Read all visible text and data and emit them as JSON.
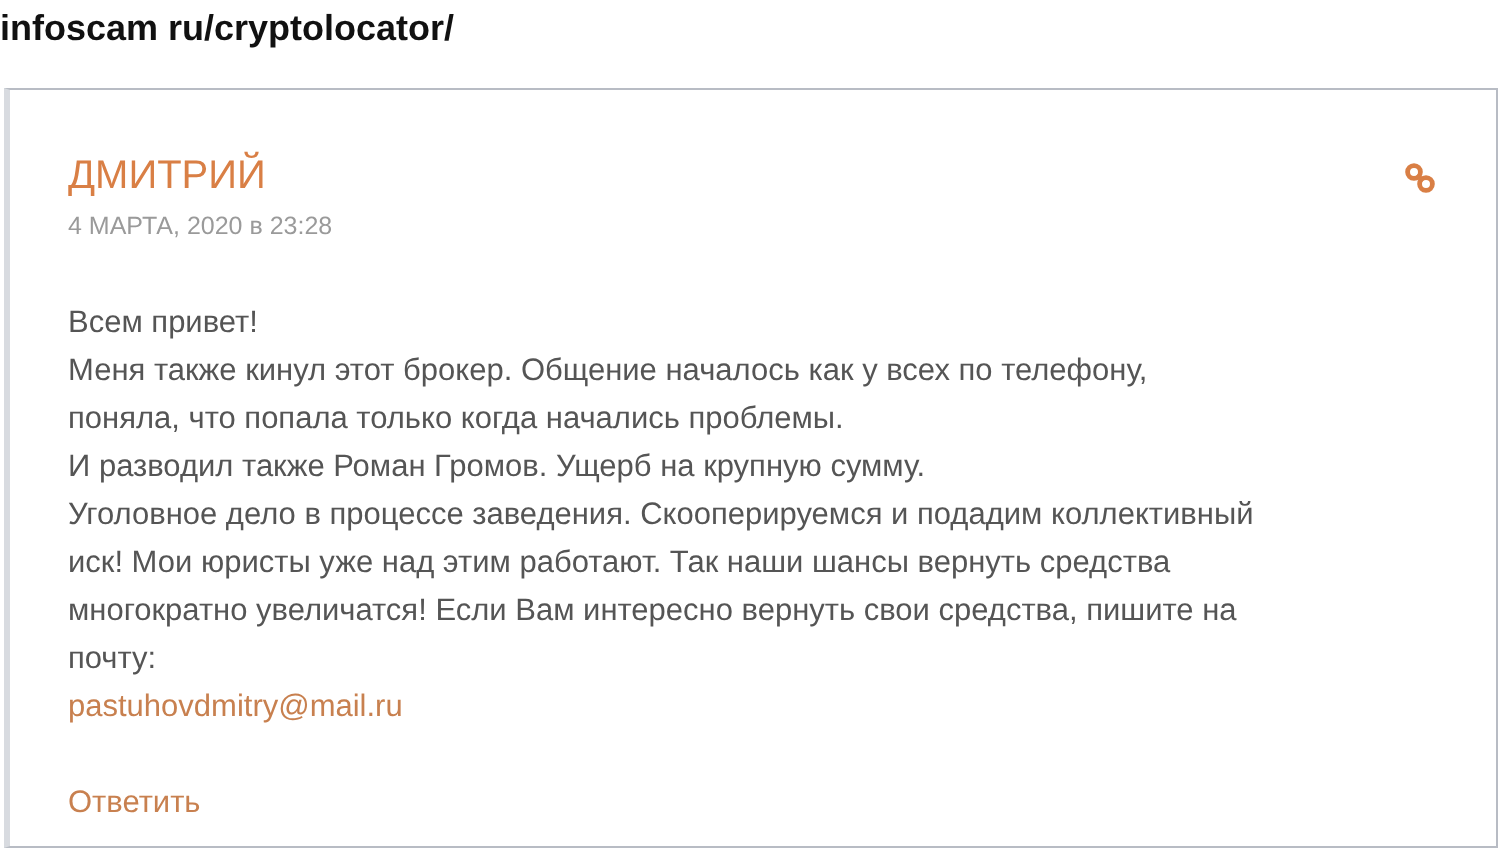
{
  "page_title": "infoscam ru/cryptolocator/",
  "comment": {
    "author": "ДМИТРИЙ",
    "date": "4 МАРТА, 2020 в 23:28",
    "lines": [
      "Всем привет!",
      "Меня также кинул этот брокер. Общение началось как у всех по телефону,",
      "поняла, что попала только когда начались проблемы.",
      "И разводил также Роман Громов. Ущерб на крупную сумму.",
      "Уголовное дело в процессе заведения. Скооперируемся и подадим коллективный",
      "иск! Мои юристы уже над этим работают. Так наши шансы вернуть средства",
      "многократно увеличатся! Если Вам интересно вернуть свои средства, пишите на",
      "почту:"
    ],
    "email": "pastuhovdmitry@mail.ru",
    "reply": "Ответить"
  }
}
